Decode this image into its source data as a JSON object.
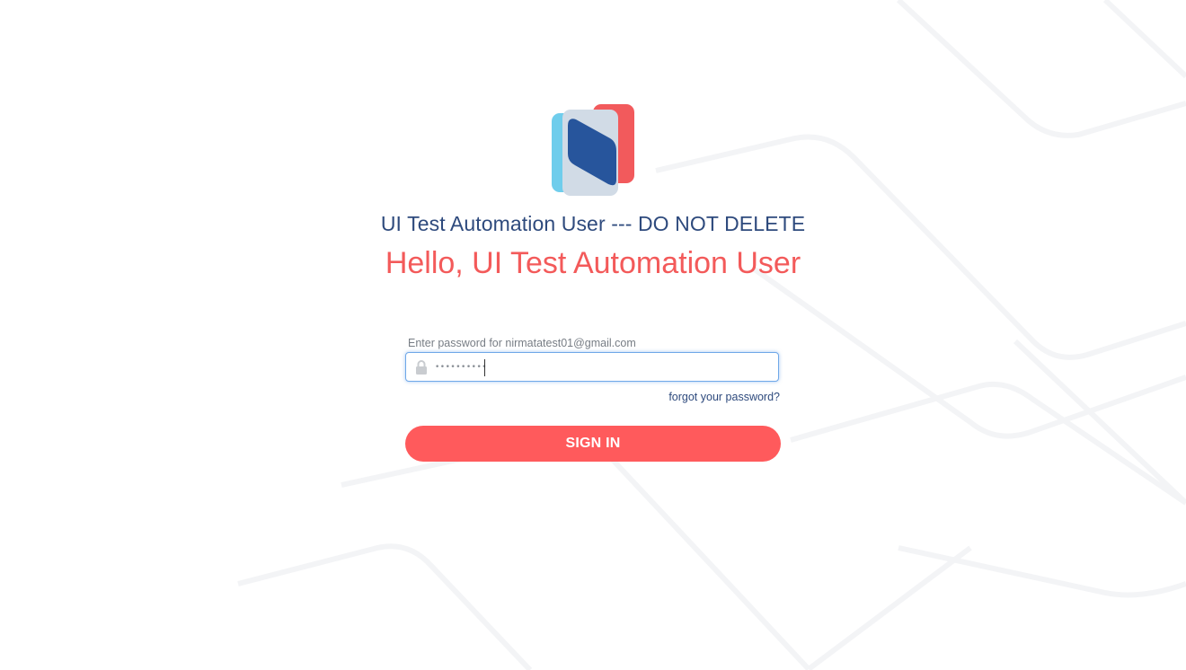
{
  "org_name": "UI Test Automation User --- DO NOT DELETE",
  "greeting": "Hello, UI Test Automation User",
  "login": {
    "field_label": "Enter password for nirmatatest01@gmail.com",
    "password_value": "••••••••••",
    "forgot_label": "forgot your password?",
    "sign_in_label": "SIGN IN"
  },
  "icons": {
    "logo": "nirmata-logo",
    "lock": "lock-icon"
  },
  "colors": {
    "accent_red": "#ff5a5c",
    "heading_blue": "#2e4a7d",
    "greeting_red": "#f35a5a",
    "logo_light_blue": "#6fcdec",
    "logo_dark_blue": "#27559c",
    "logo_gray": "#d1dbe6",
    "logo_red": "#f25a5c"
  }
}
